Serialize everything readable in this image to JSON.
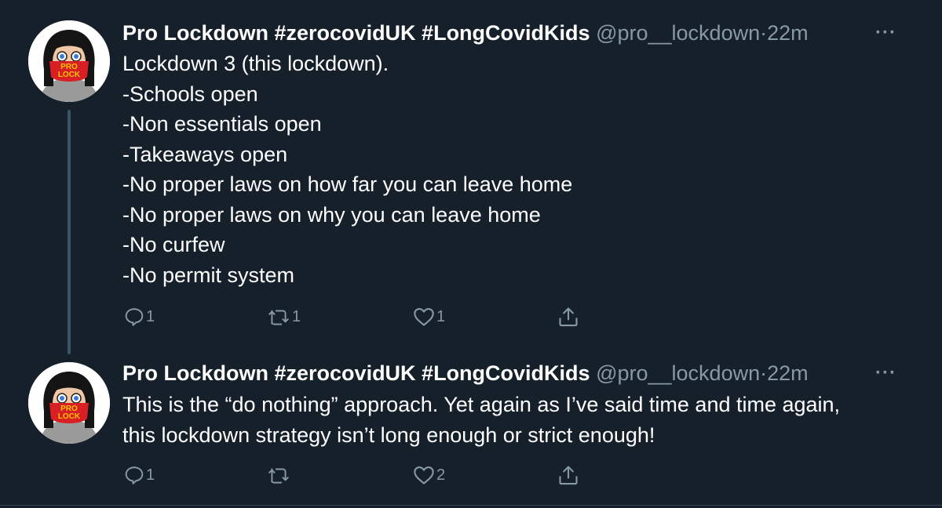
{
  "tweets": [
    {
      "name": "Pro Lockdown #zerocovidUK #LongCovidKids",
      "handle": "@pro__lockdown",
      "sep": "·",
      "time": "22m",
      "more": "···",
      "avatar_mask_text": [
        "PRO",
        "LOCK"
      ],
      "lines": [
        "Lockdown 3 (this lockdown).",
        "-Schools open",
        "-Non essentials open",
        "-Takeaways open",
        "-No proper laws on how far you can leave home",
        "-No proper laws on why you can leave home",
        "-No curfew",
        "-No permit system"
      ],
      "reply_count": "1",
      "retweet_count": "1",
      "like_count": "1"
    },
    {
      "name": "Pro Lockdown #zerocovidUK #LongCovidKids",
      "handle": "@pro__lockdown",
      "sep": "·",
      "time": "22m",
      "more": "···",
      "avatar_mask_text": [
        "PRO",
        "LOCK"
      ],
      "lines": [
        "This is the “do nothing” approach. Yet again as I’ve said time and time again,",
        "this lockdown strategy isn’t long enough or strict enough!"
      ],
      "reply_count": "1",
      "retweet_count": "",
      "like_count": "2"
    }
  ],
  "icons": {
    "reply": "reply-icon",
    "retweet": "retweet-icon",
    "like": "heart-icon",
    "share": "share-icon"
  },
  "colors": {
    "background": "#15202b",
    "text": "#ffffff",
    "secondary": "#8899a6",
    "thread_line": "#3d5466",
    "mask_red": "#d81f26",
    "mask_text": "#f5c400"
  }
}
